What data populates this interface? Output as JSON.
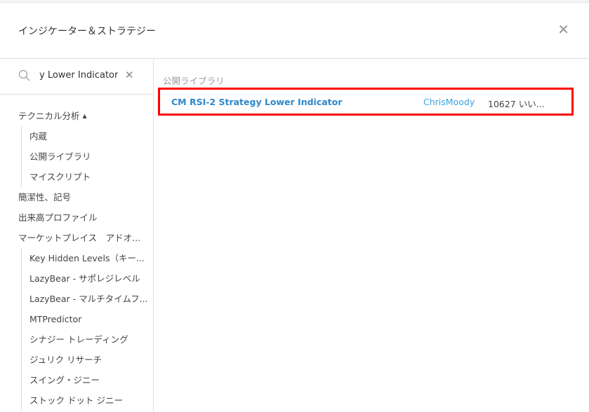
{
  "dialog": {
    "title": "インジケーター＆ストラテジー",
    "close_icon": "close-icon"
  },
  "search": {
    "value": "y Lower Indicator",
    "search_icon": "search-icon",
    "clear_icon": "clear-icon"
  },
  "sidebar": {
    "technical": "テクニカル分析",
    "technical_sub": [
      "内蔵",
      "公開ライブラリ",
      "マイスクリプト"
    ],
    "items": [
      "簡潔性、記号",
      "出来高プロファイル",
      "マーケットプレイス　アドオ..."
    ],
    "marketplace_sub": [
      "Key Hidden Levels（キー...",
      "LazyBear - サポレジレベル",
      "LazyBear - マルチタイムフ...",
      "MTPredictor",
      "シナジー トレーディング",
      "ジュリク リサーチ",
      "スイング・ジニー",
      "ストック ドット ジニー"
    ]
  },
  "results": {
    "section": "公開ライブラリ",
    "rows": [
      {
        "name": "CM RSI-2 Strategy Lower Indicator",
        "author": "ChrisMoody",
        "likes": "10627 いい..."
      }
    ]
  }
}
